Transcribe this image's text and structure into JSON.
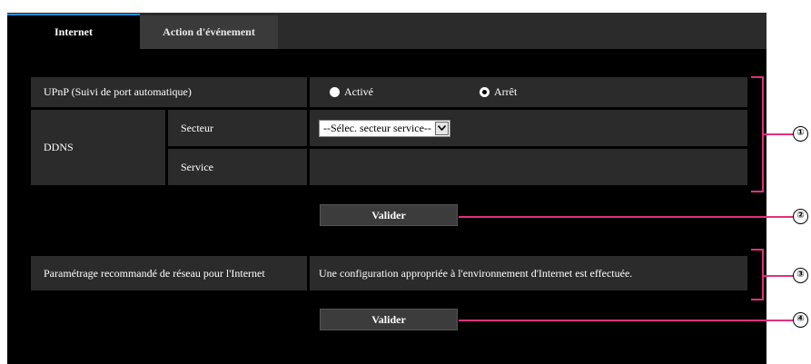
{
  "tabs": [
    {
      "label": "Internet",
      "active": true
    },
    {
      "label": "Action d'événement",
      "active": false
    }
  ],
  "upnp": {
    "label": "UPnP (Suivi de port automatique)",
    "options": [
      {
        "label": "Activé",
        "checked": false
      },
      {
        "label": "Arrêt",
        "checked": true
      }
    ]
  },
  "ddns": {
    "label": "DDNS",
    "secteur_label": "Secteur",
    "secteur_value": "--Sélec. secteur service--",
    "service_label": "Service",
    "service_value": ""
  },
  "validate1": "Valider",
  "network": {
    "label": "Paramétrage recommandé de réseau pour l'Internet",
    "description": "Une configuration appropriée à l'environnement d'Internet est effectuée."
  },
  "validate2": "Valider",
  "callouts": [
    "①",
    "②",
    "③",
    "④"
  ],
  "colors": {
    "accent_tab": "#2a8fd8",
    "callout_line": "#e0307e",
    "panel_bg": "#000000",
    "cell_bg": "#2b2b2b"
  }
}
